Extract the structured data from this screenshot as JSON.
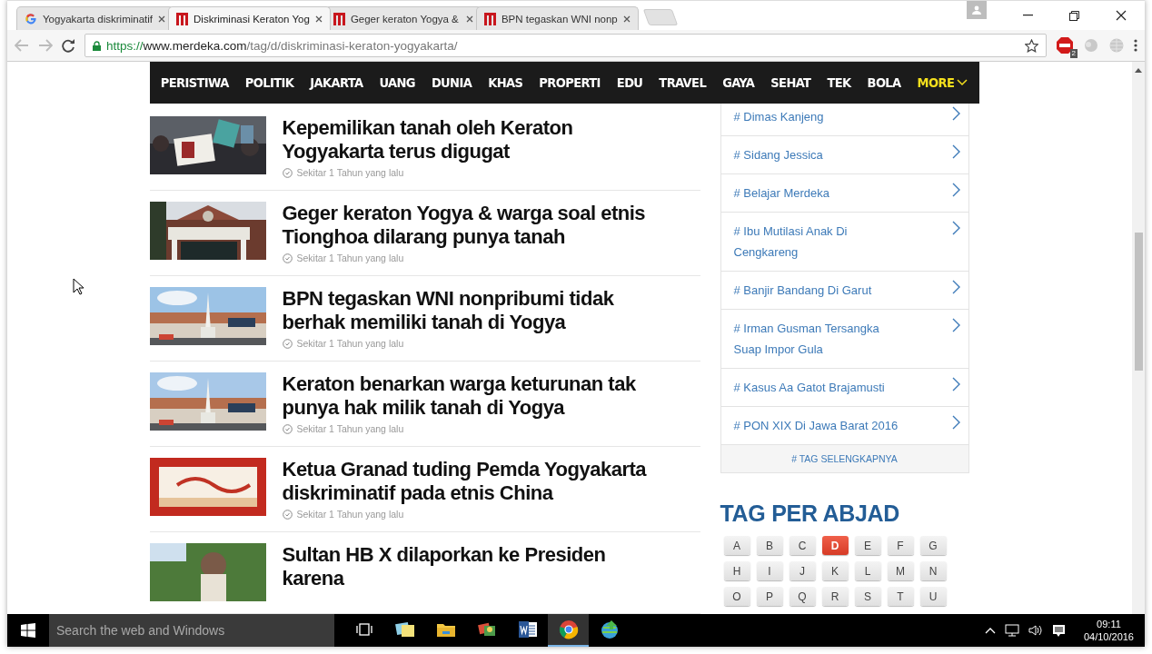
{
  "browser": {
    "tabs": [
      {
        "title": "Yogyakarta diskriminatif",
        "kind": "google",
        "selected": false
      },
      {
        "title": "Diskriminasi Keraton Yog",
        "kind": "merdeka",
        "selected": true
      },
      {
        "title": "Geger keraton Yogya &",
        "kind": "merdeka",
        "selected": false
      },
      {
        "title": "BPN tegaskan WNI nonp",
        "kind": "merdeka",
        "selected": false
      }
    ],
    "address": {
      "scheme": "https://",
      "host": "www.merdeka.com",
      "path": "/tag/d/diskriminasi-keraton-yogyakarta/"
    },
    "extension_badge": "2"
  },
  "nav": [
    {
      "label": "PERISTIWA",
      "kind": "link"
    },
    {
      "label": "POLITIK",
      "kind": "link"
    },
    {
      "label": "JAKARTA",
      "kind": "link"
    },
    {
      "label": "UANG",
      "kind": "link"
    },
    {
      "label": "DUNIA",
      "kind": "link"
    },
    {
      "label": "KHAS",
      "kind": "link"
    },
    {
      "label": "PROPERTI",
      "kind": "link"
    },
    {
      "label": "EDU",
      "kind": "link"
    },
    {
      "label": "TRAVEL",
      "kind": "link"
    },
    {
      "label": "GAYA",
      "kind": "link"
    },
    {
      "label": "SEHAT",
      "kind": "link"
    },
    {
      "label": "TEK",
      "kind": "link"
    },
    {
      "label": "BOLA",
      "kind": "link"
    },
    {
      "label": "MORE",
      "kind": "dropdown"
    }
  ],
  "articles": [
    {
      "title": "Kepemilikan tanah oleh Keraton Yogyakarta terus digugat",
      "time": "Sekitar 1 Tahun yang lalu"
    },
    {
      "title": "Geger keraton Yogya & warga soal etnis Tionghoa dilarang punya tanah",
      "time": "Sekitar 1 Tahun yang lalu"
    },
    {
      "title": "BPN tegaskan WNI nonpribumi tidak berhak memiliki tanah di Yogya",
      "time": "Sekitar 1 Tahun yang lalu"
    },
    {
      "title": "Keraton benarkan warga keturunan tak punya hak milik tanah di Yogya",
      "time": "Sekitar 1 Tahun yang lalu"
    },
    {
      "title": "Ketua Granad tuding Pemda Yogyakarta diskriminatif pada etnis China",
      "time": "Sekitar 1 Tahun yang lalu"
    },
    {
      "title": "Sultan HB X dilaporkan ke Presiden karena"
    }
  ],
  "tags": {
    "items": [
      "# Dimas Kanjeng",
      "# Sidang Jessica",
      "# Belajar Merdeka",
      "# Ibu Mutilasi Anak Di Cengkareng",
      "# Banjir Bandang Di Garut",
      "# Irman Gusman Tersangka Suap Impor Gula",
      "# Kasus Aa Gatot Brajamusti",
      "# PON XIX Di Jawa Barat 2016"
    ],
    "more": "# TAG SELENGKAPNYA"
  },
  "alphabet": {
    "title": "TAG PER ABJAD",
    "letters": [
      {
        "label": "A",
        "selected": false
      },
      {
        "label": "B",
        "selected": false
      },
      {
        "label": "C",
        "selected": false
      },
      {
        "label": "D",
        "selected": true
      },
      {
        "label": "E",
        "selected": false
      },
      {
        "label": "F",
        "selected": false
      },
      {
        "label": "G",
        "selected": false
      },
      {
        "label": "H",
        "selected": false
      },
      {
        "label": "I",
        "selected": false
      },
      {
        "label": "J",
        "selected": false
      },
      {
        "label": "K",
        "selected": false
      },
      {
        "label": "L",
        "selected": false
      },
      {
        "label": "M",
        "selected": false
      },
      {
        "label": "N",
        "selected": false
      },
      {
        "label": "O",
        "selected": false
      },
      {
        "label": "P",
        "selected": false
      },
      {
        "label": "Q",
        "selected": false
      },
      {
        "label": "R",
        "selected": false
      },
      {
        "label": "S",
        "selected": false
      },
      {
        "label": "T",
        "selected": false
      },
      {
        "label": "U",
        "selected": false
      }
    ]
  },
  "taskbar": {
    "search": {
      "placeholder": "Search the web and Windows"
    },
    "apps": [
      {
        "kind": "taskview",
        "active": false
      },
      {
        "kind": "notes",
        "active": false
      },
      {
        "kind": "folder",
        "active": false
      },
      {
        "kind": "photos",
        "active": false
      },
      {
        "kind": "word",
        "active": false
      },
      {
        "kind": "chrome",
        "active": true
      },
      {
        "kind": "globe",
        "active": false
      }
    ],
    "time": "09:11",
    "date": "04/10/2016"
  }
}
